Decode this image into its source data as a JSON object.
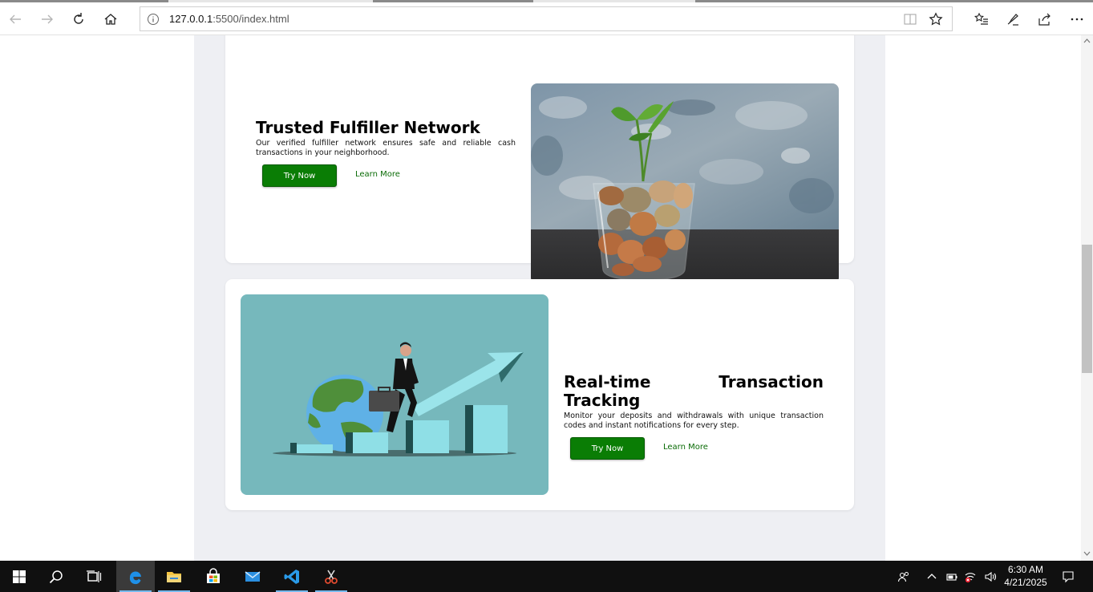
{
  "browser": {
    "url_host": "127.0.0.1",
    "url_rest": ":5500/index.html"
  },
  "cards": [
    {
      "title": "Trusted Fulfiller Network",
      "description": "Our verified fulfiller network ensures safe and reliable cash transactions in your neighborhood.",
      "primary_button": "Try Now",
      "secondary_link": "Learn More",
      "image": "plant-growing-from-coin-jar"
    },
    {
      "title": "Real-time Transaction Tracking",
      "description": "Monitor your deposits and withdrawals with unique transaction codes and instant notifications for every step.",
      "primary_button": "Try Now",
      "secondary_link": "Learn More",
      "image": "businessman-climbing-growth-chart"
    }
  ],
  "taskbar": {
    "apps": [
      "start-icon",
      "search-icon",
      "task-view-icon",
      "edge-icon",
      "file-explorer-icon",
      "store-icon",
      "mail-icon",
      "vscode-icon",
      "snipping-tool-icon"
    ],
    "time": "6:30 AM",
    "date": "4/21/2025"
  },
  "colors": {
    "button_green": "#0a7d05",
    "page_background": "#eeeff3",
    "illustration_teal": "#76b8bc"
  }
}
